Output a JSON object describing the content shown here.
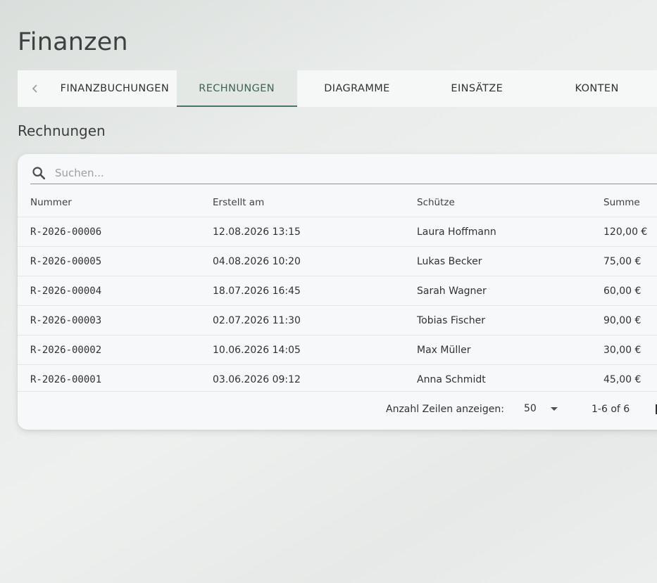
{
  "page": {
    "title": "Finanzen"
  },
  "tabs": [
    {
      "label": "FINANZBUCHUNGEN",
      "active": false
    },
    {
      "label": "RECHNUNGEN",
      "active": true
    },
    {
      "label": "DIAGRAMME",
      "active": false
    },
    {
      "label": "EINSÄTZE",
      "active": false
    },
    {
      "label": "KONTEN",
      "active": false
    }
  ],
  "section": {
    "title": "Rechnungen"
  },
  "search": {
    "placeholder": "Suchen...",
    "value": ""
  },
  "table": {
    "headers": [
      "Nummer",
      "Erstellt am",
      "Schütze",
      "Summe"
    ],
    "rows": [
      [
        "R-2026-00006",
        "12.08.2026 13:15",
        "Laura Hoffmann",
        "120,00 €"
      ],
      [
        "R-2026-00005",
        "04.08.2026 10:20",
        "Lukas Becker",
        "75,00 €"
      ],
      [
        "R-2026-00004",
        "18.07.2026 16:45",
        "Sarah Wagner",
        "60,00 €"
      ],
      [
        "R-2026-00003",
        "02.07.2026 11:30",
        "Tobias Fischer",
        "90,00 €"
      ],
      [
        "R-2026-00002",
        "10.06.2026 14:05",
        "Max Müller",
        "30,00 €"
      ],
      [
        "R-2026-00001",
        "03.06.2026 09:12",
        "Anna Schmidt",
        "45,00 €"
      ]
    ]
  },
  "pagination": {
    "rows_label": "Anzahl Zeilen anzeigen:",
    "rows_per_page": "50",
    "range": "1-6 of 6"
  },
  "colors": {
    "accent": "#4b7563",
    "active_tab_bg": "#e3e8e5",
    "card_bg": "#f6f8f9"
  },
  "icons": {
    "tab_scroll_left": "chevron-left-icon",
    "search": "search-icon",
    "rows_select": "caret-down-icon"
  }
}
